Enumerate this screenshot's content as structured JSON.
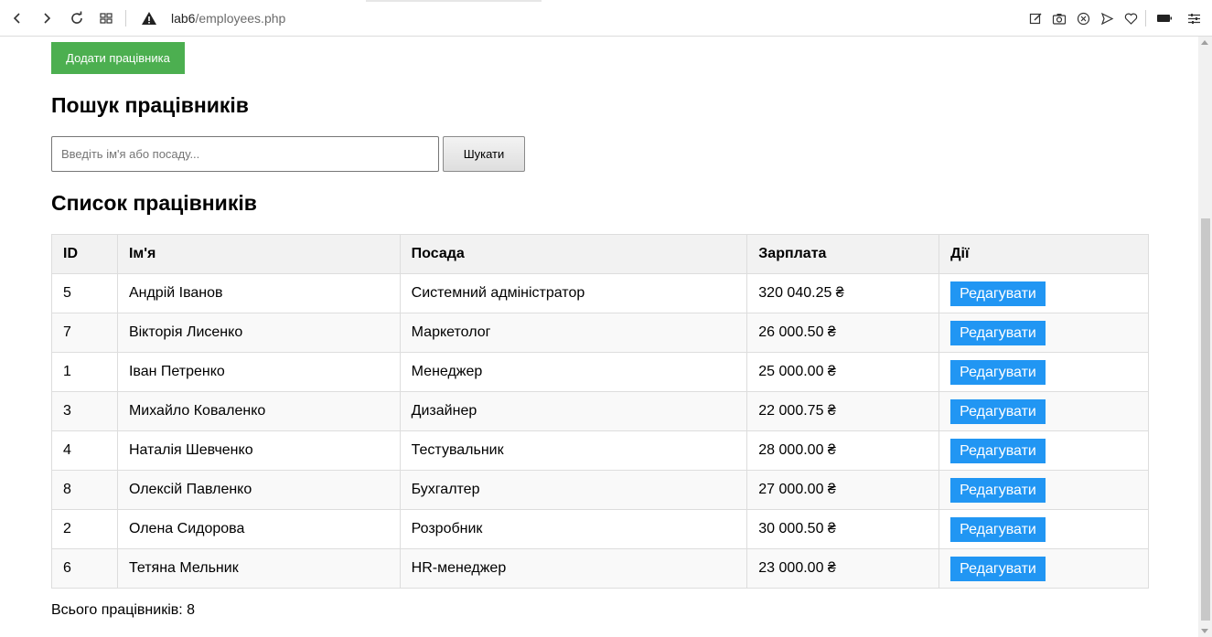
{
  "browser": {
    "address": {
      "host": "lab6",
      "path": "/employees.php"
    }
  },
  "page": {
    "add_button_label": "Додати працівника",
    "search_heading": "Пошук працівників",
    "search_placeholder": "Введіть ім'я або посаду...",
    "search_button_label": "Шукати",
    "list_heading": "Список працівників",
    "table": {
      "headers": [
        "ID",
        "Ім'я",
        "Посада",
        "Зарплата",
        "Дії"
      ],
      "rows": [
        {
          "id": "5",
          "name": "Андрій Іванов",
          "position": "Системний адміністратор",
          "salary": "320 040.25 ₴",
          "action": "Редагувати"
        },
        {
          "id": "7",
          "name": "Вікторія Лисенко",
          "position": "Маркетолог",
          "salary": "26 000.50 ₴",
          "action": "Редагувати"
        },
        {
          "id": "1",
          "name": "Іван Петренко",
          "position": "Менеджер",
          "salary": "25 000.00 ₴",
          "action": "Редагувати"
        },
        {
          "id": "3",
          "name": "Михайло Коваленко",
          "position": "Дизайнер",
          "salary": "22 000.75 ₴",
          "action": "Редагувати"
        },
        {
          "id": "4",
          "name": "Наталія Шевченко",
          "position": "Тестувальник",
          "salary": "28 000.00 ₴",
          "action": "Редагувати"
        },
        {
          "id": "8",
          "name": "Олексій Павленко",
          "position": "Бухгалтер",
          "salary": "27 000.00 ₴",
          "action": "Редагувати"
        },
        {
          "id": "2",
          "name": "Олена Сидорова",
          "position": "Розробник",
          "salary": "30 000.50 ₴",
          "action": "Редагувати"
        },
        {
          "id": "6",
          "name": "Тетяна Мельник",
          "position": "HR-менеджер",
          "salary": "23 000.00 ₴",
          "action": "Редагувати"
        }
      ]
    },
    "total_text": "Всього працівників: 8"
  },
  "colors": {
    "add_button": "#4caf50",
    "edit_button": "#2196f3",
    "header_bg": "#f2f2f2"
  },
  "icons": [
    "back-icon",
    "forward-icon",
    "reload-icon",
    "tabs-grid-icon",
    "warning-icon",
    "edit-page-icon",
    "camera-icon",
    "block-icon",
    "send-icon",
    "heart-icon",
    "battery-icon",
    "settings-icon"
  ]
}
